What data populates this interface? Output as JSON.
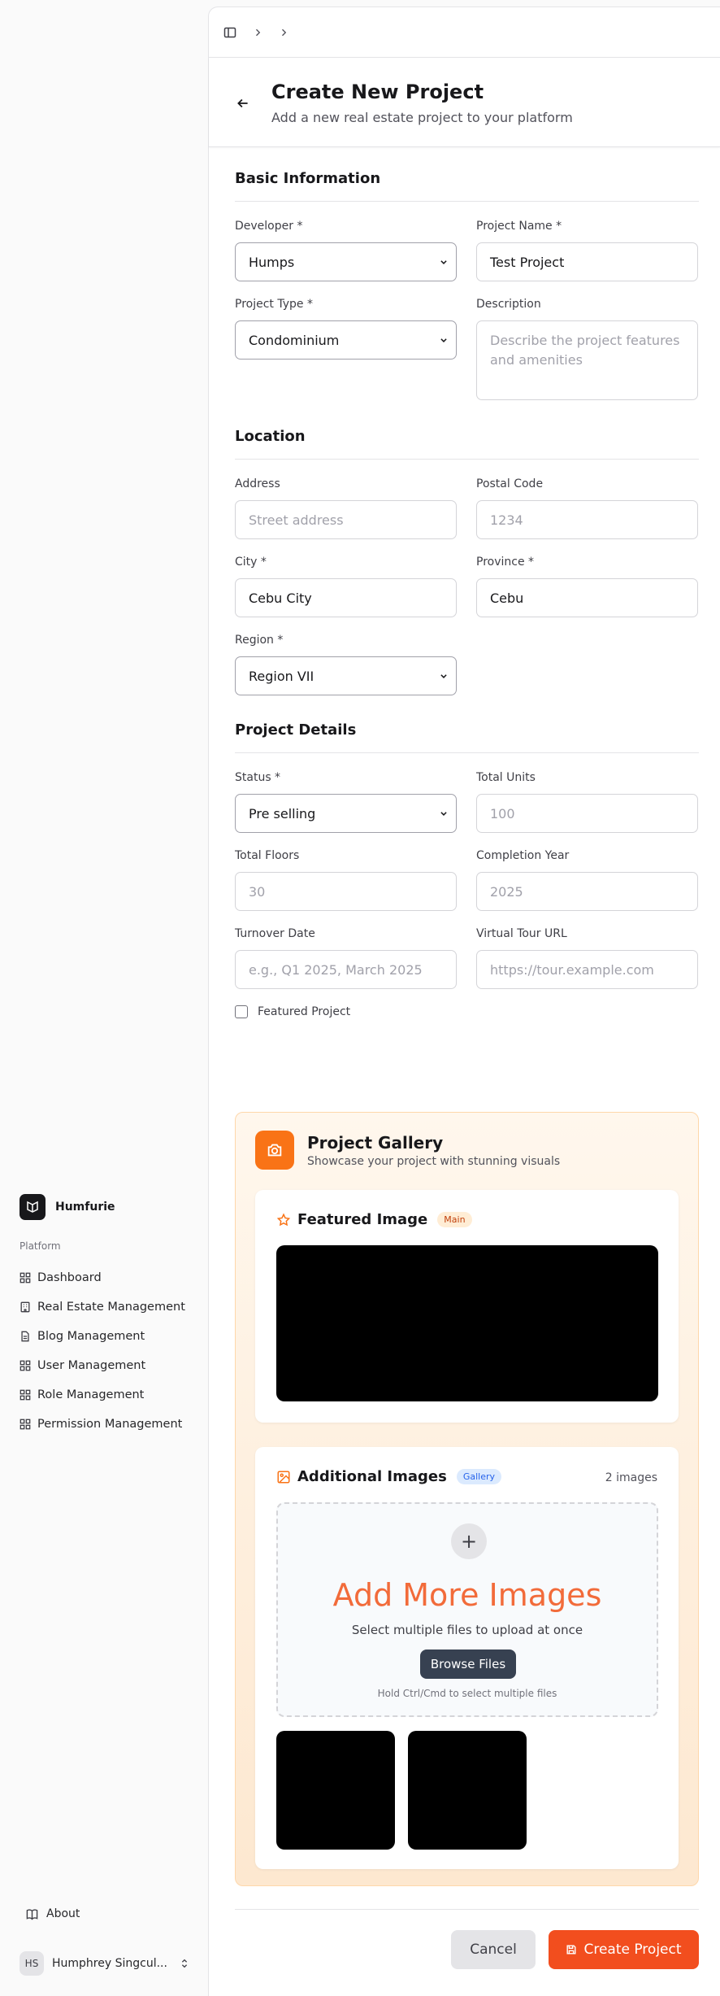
{
  "sidebar": {
    "brand": "Humfurie",
    "section_heading": "Platform",
    "items": [
      {
        "label": "Dashboard",
        "icon": "grid-icon"
      },
      {
        "label": "Real Estate Management",
        "icon": "building-icon"
      },
      {
        "label": "Blog Management",
        "icon": "document-icon"
      },
      {
        "label": "User Management",
        "icon": "grid-icon"
      },
      {
        "label": "Role Management",
        "icon": "grid-icon"
      },
      {
        "label": "Permission Management",
        "icon": "grid-icon"
      }
    ],
    "about": "About",
    "user": {
      "initials": "HS",
      "name": "Humphrey Singcul..."
    }
  },
  "header": {
    "title": "Create New Project",
    "subtitle": "Add a new real estate project to your platform"
  },
  "form": {
    "basic": {
      "title": "Basic Information",
      "developer": {
        "label": "Developer *",
        "value": "Humps"
      },
      "project_name": {
        "label": "Project Name *",
        "value": "Test Project"
      },
      "project_type": {
        "label": "Project Type *",
        "value": "Condominium"
      },
      "description": {
        "label": "Description",
        "placeholder": "Describe the project features and amenities"
      }
    },
    "location": {
      "title": "Location",
      "address": {
        "label": "Address",
        "placeholder": "Street address"
      },
      "postal_code": {
        "label": "Postal Code",
        "placeholder": "1234"
      },
      "city": {
        "label": "City *",
        "value": "Cebu City"
      },
      "province": {
        "label": "Province *",
        "value": "Cebu"
      },
      "region": {
        "label": "Region *",
        "value": "Region VII"
      }
    },
    "details": {
      "title": "Project Details",
      "status": {
        "label": "Status *",
        "value": "Pre selling"
      },
      "total_units": {
        "label": "Total Units",
        "placeholder": "100"
      },
      "total_floors": {
        "label": "Total Floors",
        "placeholder": "30"
      },
      "completion_year": {
        "label": "Completion Year",
        "placeholder": "2025"
      },
      "turnover_date": {
        "label": "Turnover Date",
        "placeholder": "e.g., Q1 2025, March 2025"
      },
      "virtual_tour": {
        "label": "Virtual Tour URL",
        "placeholder": "https://tour.example.com"
      },
      "featured": {
        "label": "Featured Project",
        "checked": false
      }
    }
  },
  "gallery": {
    "title": "Project Gallery",
    "subtitle": "Showcase your project with stunning visuals",
    "featured": {
      "title": "Featured Image",
      "badge": "Main"
    },
    "additional": {
      "title": "Additional Images",
      "badge": "Gallery",
      "count": "2 images",
      "dropzone_title": "Add More Images",
      "dropzone_sub": "Select multiple files to upload at once",
      "browse": "Browse Files",
      "hint": "Hold Ctrl/Cmd to select multiple files"
    }
  },
  "actions": {
    "cancel": "Cancel",
    "create": "Create Project"
  },
  "colors": {
    "accent": "#f24e1e",
    "gallery_bg": "#fff7ed"
  }
}
